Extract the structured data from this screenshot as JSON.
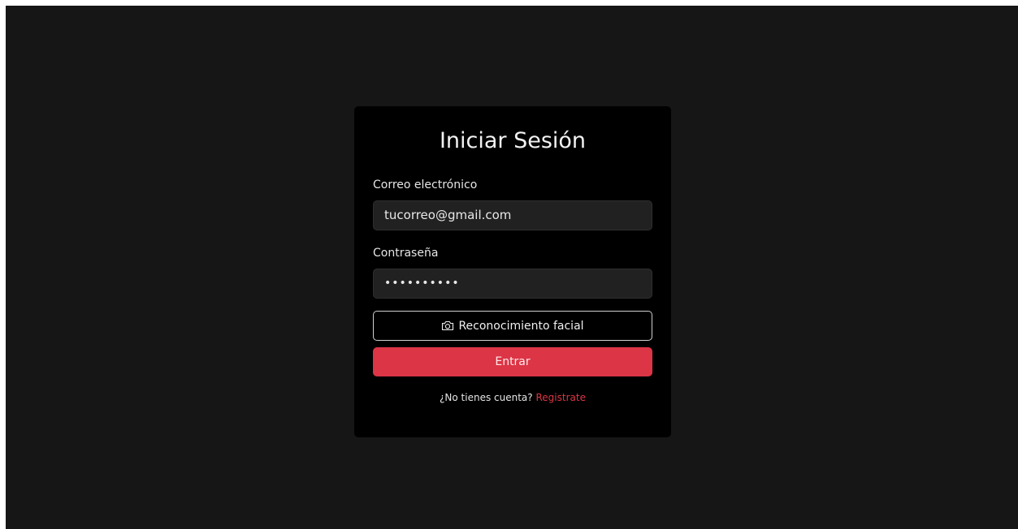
{
  "login": {
    "title": "Iniciar Sesión",
    "email_label": "Correo electrónico",
    "email_value": "tucorreo@gmail.com",
    "password_label": "Contraseña",
    "password_value": "••••••••••",
    "face_button_label": "Reconocimiento facial",
    "face_button_icon": "camera-icon",
    "submit_label": "Entrar",
    "no_account_text": "¿No tienes cuenta?",
    "register_link": "Registrate"
  },
  "colors": {
    "background": "#161616",
    "card": "#000000",
    "input_bg": "#212121",
    "accent": "#dc3545"
  }
}
